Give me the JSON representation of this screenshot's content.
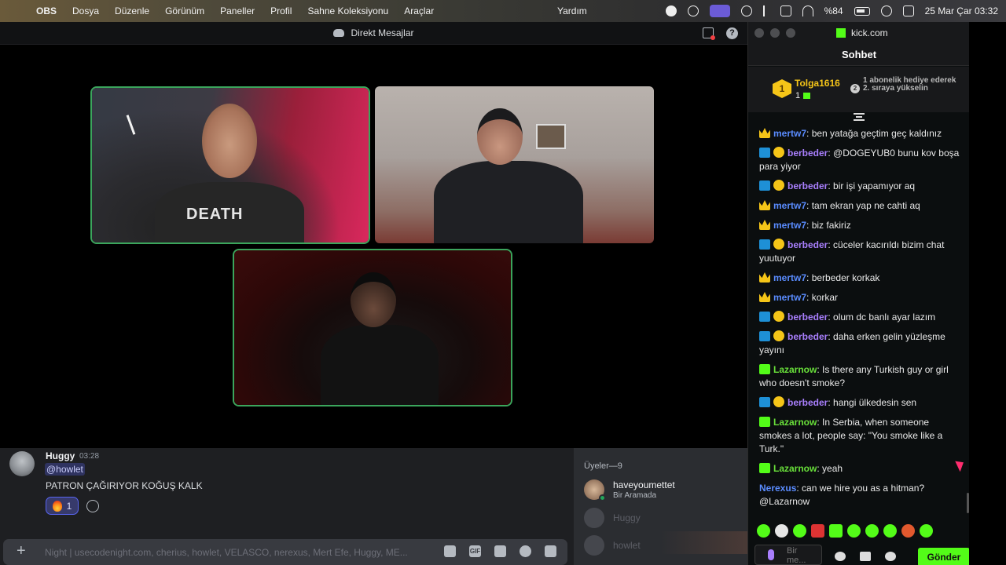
{
  "menubar": {
    "app_name": "OBS",
    "items": [
      "Dosya",
      "Düzenle",
      "Görünüm",
      "Paneller",
      "Profil",
      "Sahne Koleksiyonu",
      "Araçlar"
    ],
    "help": "Yardım",
    "battery": "%84",
    "clock": "25 Mar Çar  03:32"
  },
  "discord": {
    "header_title": "Direkt Mesajlar",
    "message": {
      "author": "Huggy",
      "time": "03:28",
      "mention": "@howlet",
      "text": "PATRON ÇAĞIRIYOR KOĞUŞ KALK",
      "reaction_count": "1"
    },
    "members": {
      "heading": "Üyeler—9",
      "items": [
        {
          "name": "haveyoumettet",
          "status": "Bir Aramada"
        },
        {
          "name": "Huggy",
          "status": ""
        },
        {
          "name": "howlet",
          "status": ""
        }
      ]
    },
    "composer_placeholder": "Night | usecodenight.com, cherius, howlet, VELASCO, nerexus, Mert Efe, Huggy, ME...",
    "accent": "#5865f2",
    "speaking_color": "#3ba55c"
  },
  "kick": {
    "url": "kick.com",
    "title": "Sohbet",
    "leaderboard": {
      "rank1": "1",
      "name": "Tolga1616",
      "count": "1",
      "rank2": "2",
      "note": "1 abonelik hediye ederek 2. sıraya yükselin"
    },
    "messages": [
      {
        "user": "mertw7",
        "text": "ben yatağa geçtim geç kaldınız"
      },
      {
        "user": "berbeder",
        "text": "@DOGEYUB0 bunu kov boşa para yiyor"
      },
      {
        "user": "berbeder",
        "text": "bir işi yapamıyor aq"
      },
      {
        "user": "mertw7",
        "text": "tam ekran yap ne cahti aq"
      },
      {
        "user": "mertw7",
        "text": "biz fakiriz"
      },
      {
        "user": "berbeder",
        "text": "cüceler kacırıldı bizim chat yuutuyor"
      },
      {
        "user": "mertw7",
        "text": "berbeder korkak"
      },
      {
        "user": "mertw7",
        "text": "korkar"
      },
      {
        "user": "berbeder",
        "text": "olum dc banlı ayar lazım"
      },
      {
        "user": "berbeder",
        "text": "daha erken gelin yüzleşme yayını"
      },
      {
        "user": "Lazarnow",
        "text": "Is there any Turkish guy or girl who doesn't smoke?"
      },
      {
        "user": "berbeder",
        "text": "hangi ülkedesin sen"
      },
      {
        "user": "Lazarnow",
        "text": "In Serbia, when someone smokes a lot, people say: \"You smoke like a Turk.\""
      },
      {
        "user": "Lazarnow",
        "text": "yeah"
      },
      {
        "user": "Nerexus",
        "text": "can we hire you as a hitman? @Lazarnow"
      }
    ],
    "input_placeholder": "Bir me...",
    "send_label": "Gönder",
    "brand_color": "#53fc18"
  }
}
